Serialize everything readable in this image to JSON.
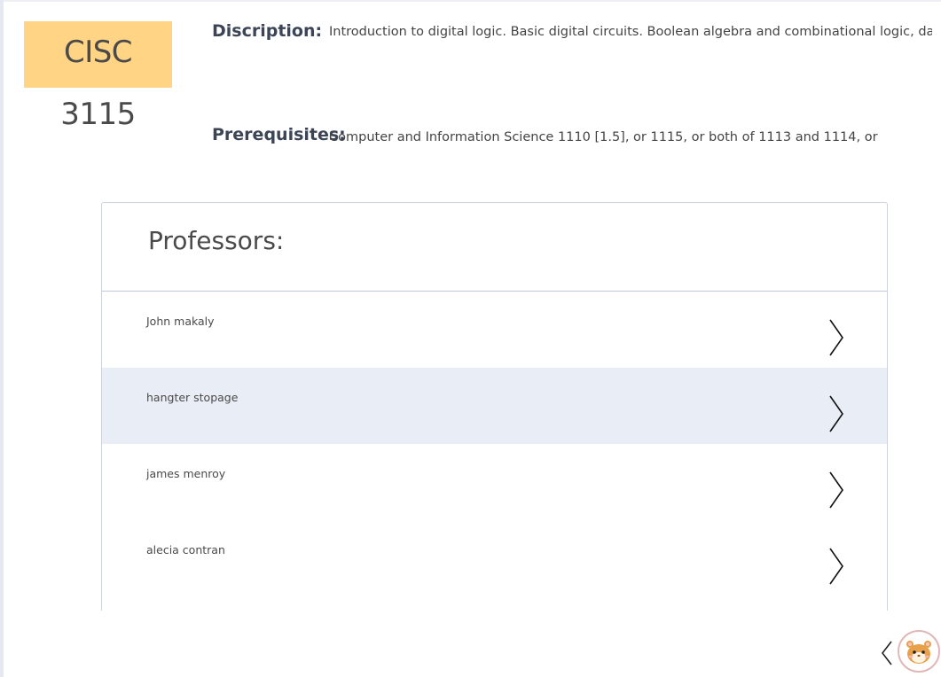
{
  "course": {
    "code": "CISC 3115"
  },
  "description": {
    "label": "Discription:",
    "text": "Introduction to digital logic. Basic digital circuits. Boolean algebra and combinational logic, data"
  },
  "prerequisites": {
    "label": "Prerequisites:",
    "text": "Computer and Information Science 1110 [1.5], or 1115, or both of 1113 and 1114, or"
  },
  "professors": {
    "title": "Professors:",
    "items": [
      {
        "name": "John makaly"
      },
      {
        "name": "hangter stopage"
      },
      {
        "name": "james menroy"
      },
      {
        "name": "alecia contran"
      }
    ]
  },
  "colors": {
    "course_badge": "#ffd485",
    "row_highlight": "#e9edf5",
    "label_text": "#3c4556"
  },
  "icons": {
    "row_chevron": "chevron-right-icon",
    "back": "chevron-left-icon",
    "avatar": "hamster-avatar-icon"
  }
}
